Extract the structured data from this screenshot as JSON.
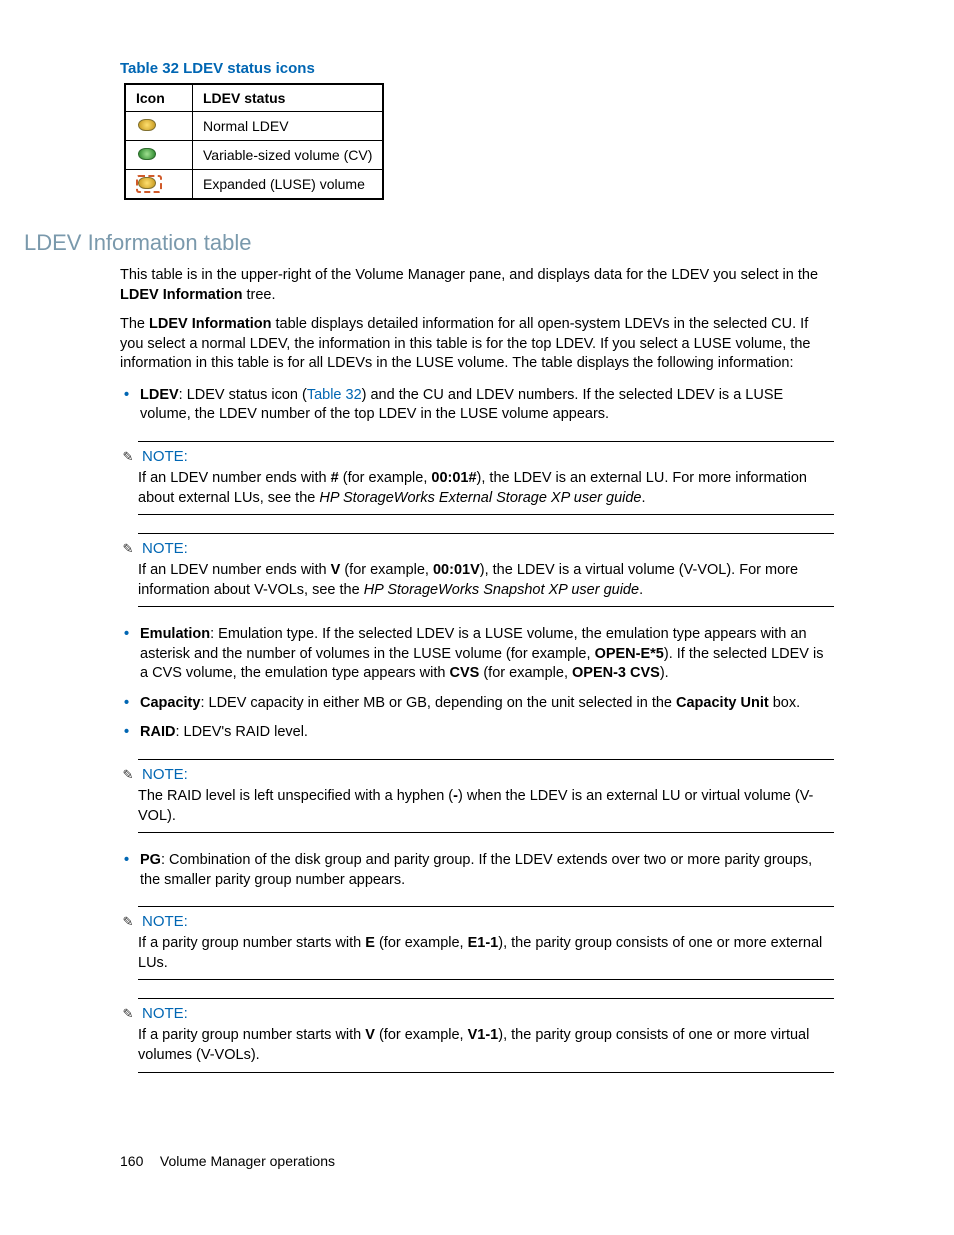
{
  "table": {
    "caption": "Table 32 LDEV status icons",
    "headers": {
      "icon": "Icon",
      "status": "LDEV status"
    },
    "rows": [
      {
        "status": "Normal LDEV"
      },
      {
        "status": "Variable-sized volume (CV)"
      },
      {
        "status": "Expanded (LUSE) volume"
      }
    ]
  },
  "section_heading": "LDEV Information table",
  "para1_a": "This table is in the upper-right of the Volume Manager pane, and displays data for the LDEV you select in the ",
  "para1_bold": "LDEV Information",
  "para1_b": " tree.",
  "para2_a": "The ",
  "para2_bold": "LDEV Information",
  "para2_b": " table displays detailed information for all open-system LDEVs in the selected CU. If you select a normal LDEV, the information in this table is for the top LDEV. If you select a LUSE volume, the information in this table is for all LDEVs in the LUSE volume. The table displays the following information:",
  "bullets1": {
    "ldev_label": "LDEV",
    "ldev_a": ": LDEV status icon (",
    "ldev_link": "Table 32",
    "ldev_b": ") and the CU and LDEV numbers. If the selected LDEV is a LUSE volume, the LDEV number of the top LDEV in the LUSE volume appears."
  },
  "note1": {
    "head": "NOTE:",
    "a": "If an LDEV number ends with ",
    "b1": "#",
    "c": " (for example, ",
    "b2": "00:01#",
    "d": "), the LDEV is an external LU. For more information about external LUs, see the ",
    "ital": "HP StorageWorks External Storage XP user guide",
    "e": "."
  },
  "note2": {
    "head": "NOTE:",
    "a": "If an LDEV number ends with ",
    "b1": "V",
    "c": " (for example, ",
    "b2": "00:01V",
    "d": "), the LDEV is a virtual volume (V-VOL). For more information about V-VOLs, see the ",
    "ital": "HP StorageWorks Snapshot XP user guide",
    "e": "."
  },
  "bullets2": {
    "emu_label": "Emulation",
    "emu_a": ": Emulation type. If the selected LDEV is a LUSE volume, the emulation type appears with an asterisk and the number of volumes in the LUSE volume (for example, ",
    "emu_b1": "OPEN-E*5",
    "emu_b": "). If the selected LDEV is a CVS volume, the emulation type appears with ",
    "emu_b2": "CVS",
    "emu_c": " (for example, ",
    "emu_b3": "OPEN-3 CVS",
    "emu_d": ").",
    "cap_label": "Capacity",
    "cap_a": ": LDEV capacity in either MB or GB, depending on the unit selected in the ",
    "cap_b1": "Capacity Unit",
    "cap_b": " box.",
    "raid_label": "RAID",
    "raid_a": ": LDEV's RAID level."
  },
  "note3": {
    "head": "NOTE:",
    "a": "The RAID level is left unspecified with a hyphen (",
    "b1": "-",
    "c": ") when the LDEV is an external LU or virtual volume (V-VOL)."
  },
  "bullets3": {
    "pg_label": "PG",
    "pg_a": ": Combination of the disk group and parity group. If the LDEV extends over two or more parity groups, the smaller parity group number appears."
  },
  "note4": {
    "head": "NOTE:",
    "a": "If a parity group number starts with ",
    "b1": "E",
    "c": " (for example, ",
    "b2": "E1-1",
    "d": "), the parity group consists of one or more external LUs."
  },
  "note5": {
    "head": "NOTE:",
    "a": "If a parity group number starts with ",
    "b1": "V",
    "c": " (for example, ",
    "b2": "V1-1",
    "d": "), the parity group consists of one or more virtual volumes (V-VOLs)."
  },
  "footer": {
    "page": "160",
    "title": "Volume Manager operations"
  }
}
